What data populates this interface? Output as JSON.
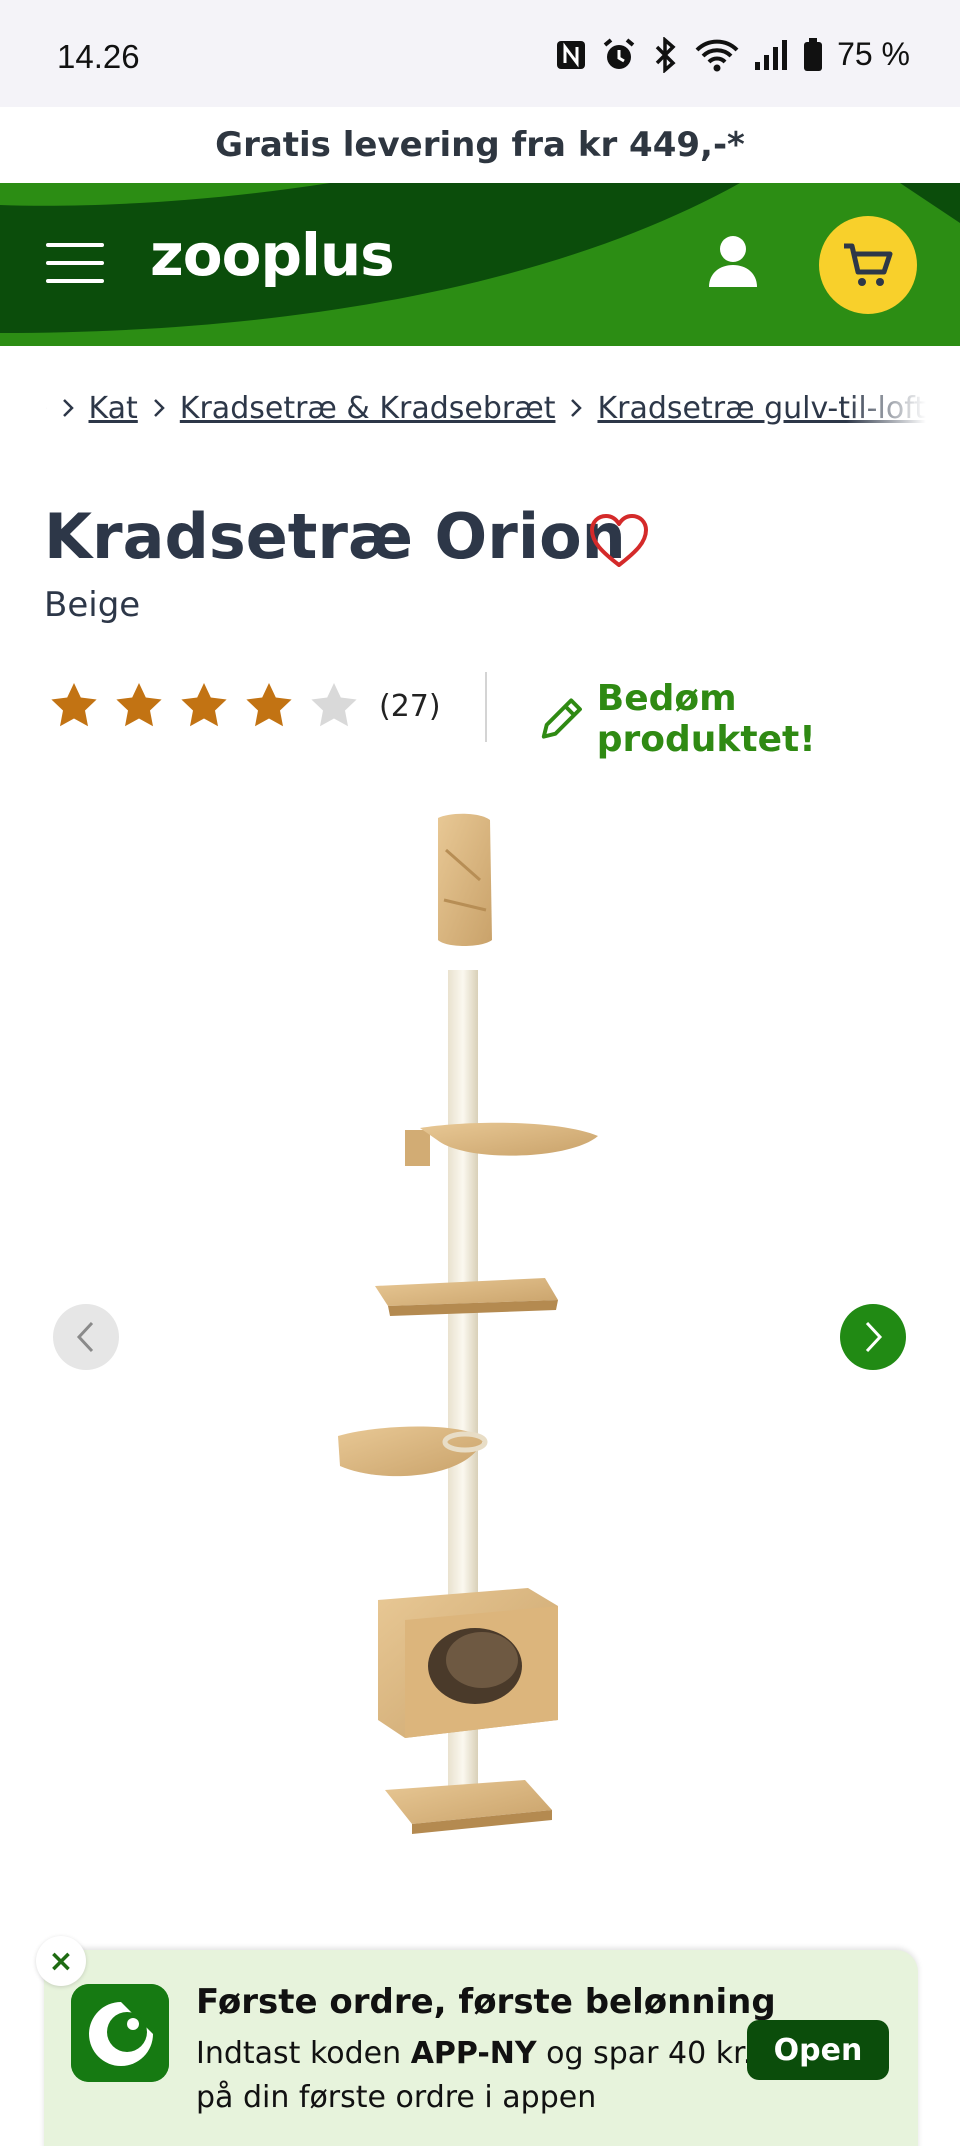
{
  "status_bar": {
    "time": "14.26",
    "battery": "75 %",
    "icons": [
      "nfc-icon",
      "alarm-icon",
      "bluetooth-icon",
      "wifi-icon",
      "signal-icon",
      "battery-icon"
    ]
  },
  "promo": {
    "text": "Gratis levering fra kr 449,-*"
  },
  "header": {
    "logo": "zooplus",
    "colors": {
      "dark_green": "#0b4d0b",
      "bright_green": "#2c8d14",
      "cart_yellow": "#f8d02b"
    }
  },
  "breadcrumb": {
    "items": [
      "Kat",
      "Kradsetræ & Kradsebræt",
      "Kradsetræ gulv-til-loft"
    ]
  },
  "product": {
    "title": "Kradsetræ Orion",
    "variant": "Beige",
    "rating": 4,
    "rating_max": 5,
    "review_count": "(27)",
    "review_cta": "Bedøm produktet!"
  },
  "gallery": {
    "image_alt": "cat-tree-image"
  },
  "app_banner": {
    "close": "×",
    "headline": "Første ordre, første belønning",
    "body_prefix": "Indtast koden ",
    "code": "APP-NY",
    "body_suffix": " og spar 40 kr. på din første ordre i appen",
    "button": "Open"
  }
}
